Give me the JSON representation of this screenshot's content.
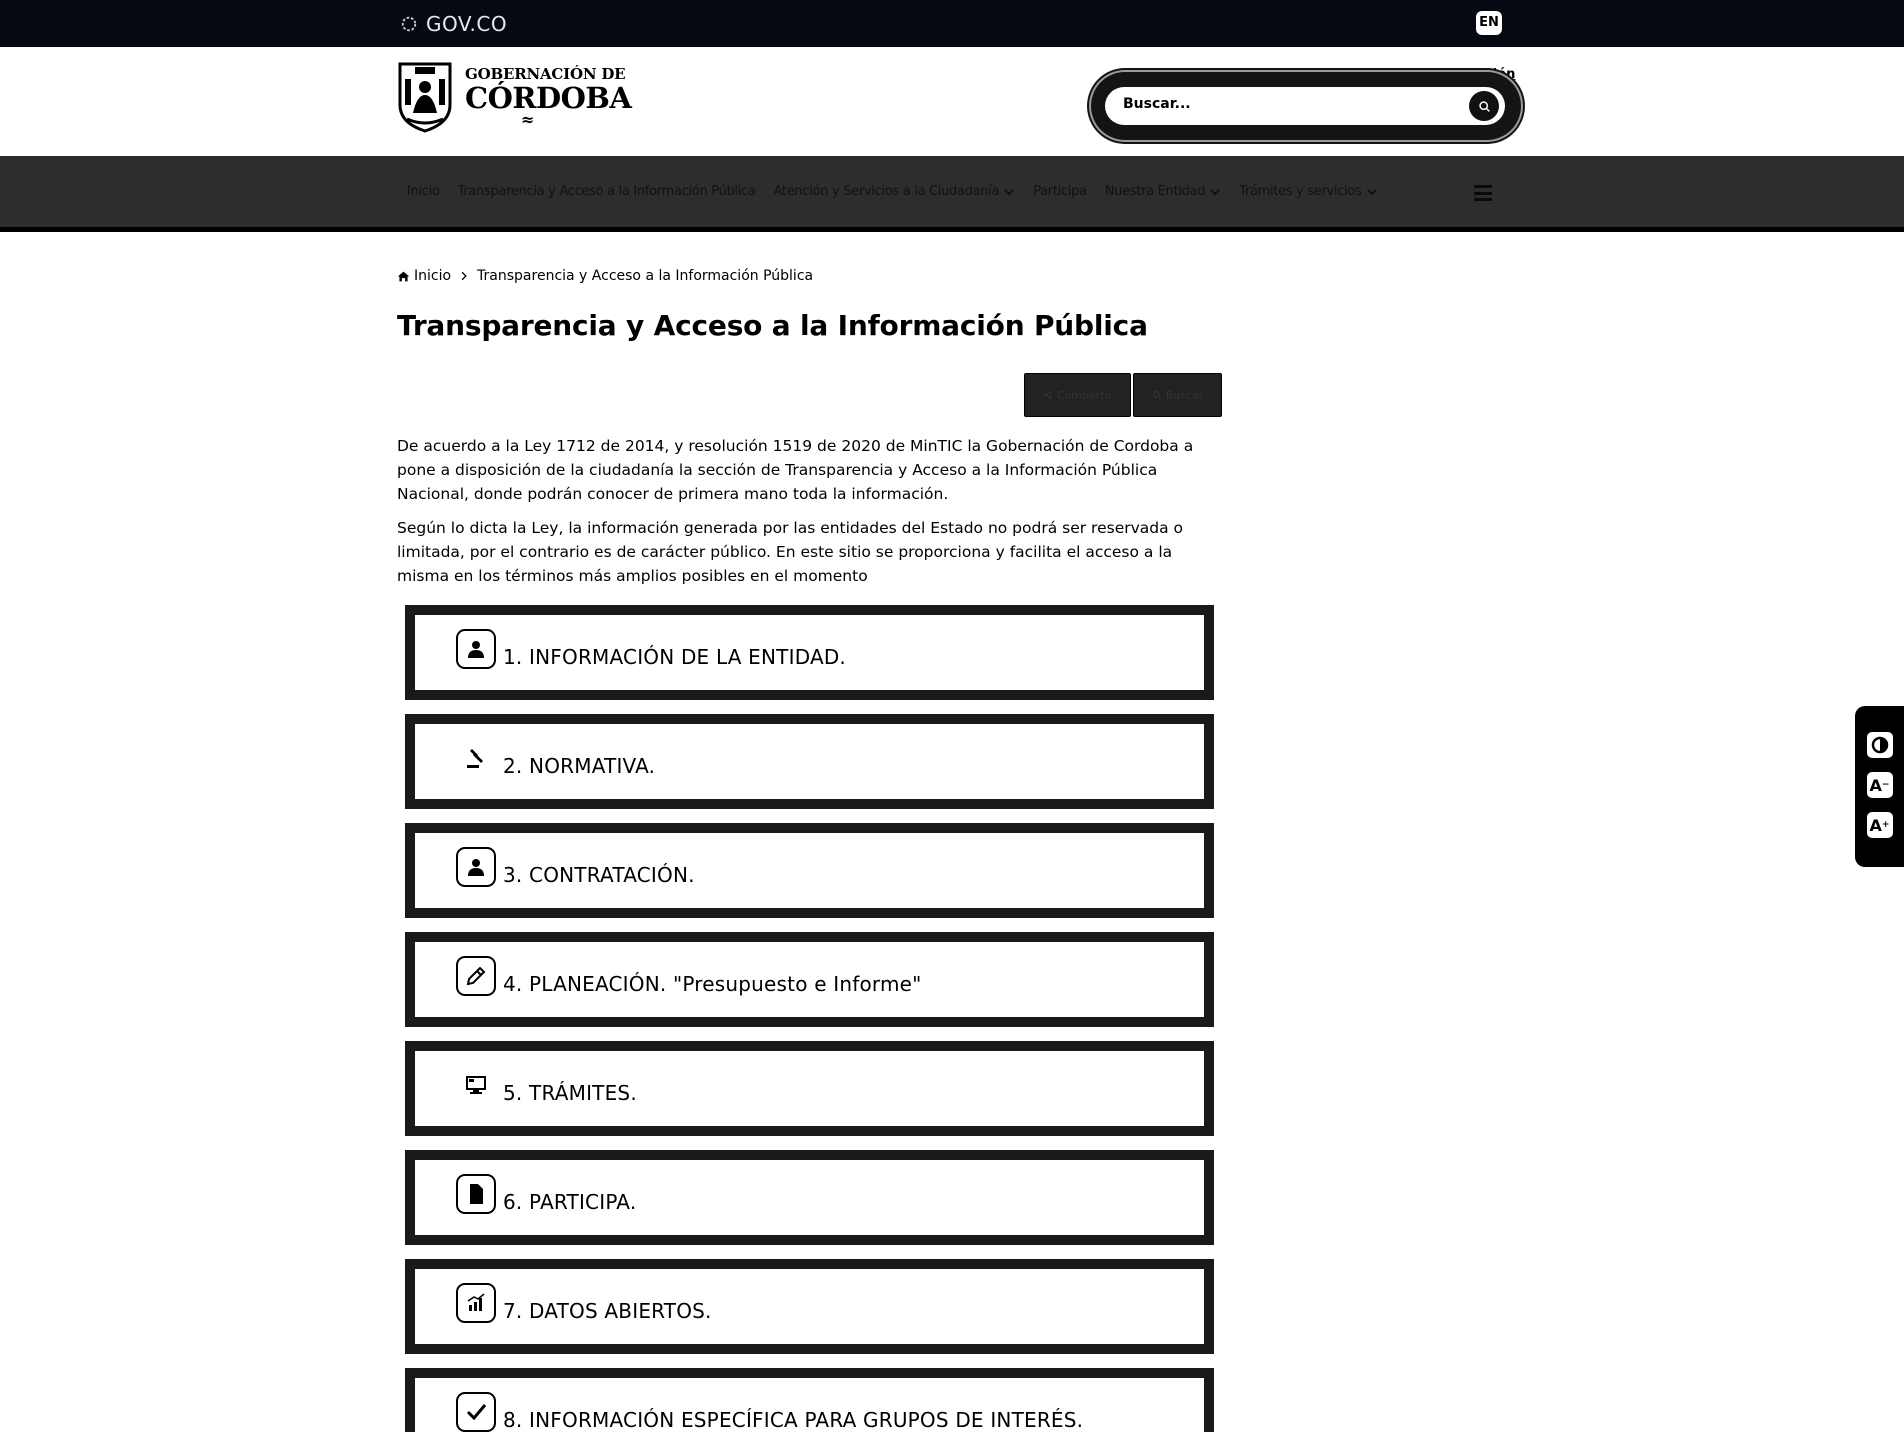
{
  "govbar": {
    "logo_text": "GOV.CO",
    "lang_button": "EN"
  },
  "header": {
    "brand_line1": "GOBERNACIÓN DE",
    "brand_line2": "CÓRDOBA",
    "brand_waves": "≈",
    "login_label": "Iniciar sesión",
    "search_placeholder": "Buscar..."
  },
  "nav": {
    "items": [
      {
        "label": "Inicio",
        "dropdown": false
      },
      {
        "label": "Transparencia y Acceso a la Información Pública",
        "dropdown": false
      },
      {
        "label": "Atención y Servicios a la Ciudadanía",
        "dropdown": true
      },
      {
        "label": "Participa",
        "dropdown": false
      },
      {
        "label": "Nuestra Entidad",
        "dropdown": true
      },
      {
        "label": "Trámites y servicios",
        "dropdown": true
      }
    ]
  },
  "breadcrumb": {
    "home": "Inicio",
    "current": "Transparencia y Acceso a la Información Pública"
  },
  "page_title": "Transparencia y Acceso a la Información Pública",
  "actions": {
    "share": "Compartir",
    "search": "Buscar"
  },
  "intro": {
    "p1": "De acuerdo a la Ley 1712 de 2014, y resolución 1519 de 2020 de MinTIC la Gobernación de Cordoba a pone a disposición de la ciudadanía la sección de Transparencia y Acceso a la Información Pública Nacional, donde podrán conocer de primera mano toda la información.",
    "p2": "Según lo dicta la Ley, la información generada por las entidades del Estado no podrá ser reservada o limitada, por el contrario es de carácter público. En este sitio se proporciona y facilita el acceso a la misma en los términos más amplios posibles en el momento"
  },
  "sections": [
    {
      "label": "1. INFORMACIÓN DE LA ENTIDAD.",
      "icon": "person-icon"
    },
    {
      "label": "2.  NORMATIVA.",
      "icon": "gavel-icon"
    },
    {
      "label": "3.  CONTRATACIÓN.",
      "icon": "person-icon"
    },
    {
      "label": "4. PLANEACIÓN. \"Presupuesto e Informe\"",
      "icon": "pencil-icon"
    },
    {
      "label": "5.  TRÁMITES.",
      "icon": "monitor-icon"
    },
    {
      "label": "6.  PARTICIPA.",
      "icon": "document-icon"
    },
    {
      "label": "7. DATOS ABIERTOS.",
      "icon": "chart-icon"
    },
    {
      "label": "8.  INFORMACIÓN ESPECÍFICA PARA GRUPOS DE INTERÉS.",
      "icon": "check-icon"
    }
  ],
  "a11y": {
    "contrast_icon": "contrast-icon",
    "font_decrease_icon": "font-decrease-icon",
    "font_increase_icon": "font-increase-icon"
  }
}
